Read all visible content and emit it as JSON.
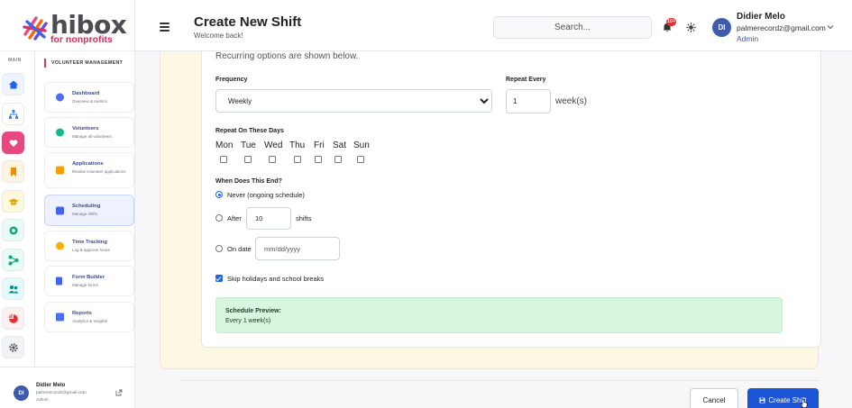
{
  "brand": {
    "name": "hibox",
    "tagline": "for nonprofits"
  },
  "header": {
    "title": "Create New Shift",
    "subtitle": "Welcome back!",
    "search_placeholder": "Search...",
    "notification_count": "10+",
    "user": {
      "initials": "DI",
      "name": "Didier Melo",
      "email": "palmerecordz@gmail.com",
      "role": "Admin"
    }
  },
  "rail": {
    "label": "MAIN",
    "items": [
      {
        "icon": "home-icon",
        "color": "#1c64f2",
        "bg": "#eef4ff"
      },
      {
        "icon": "org-chart-icon",
        "color": "#3b82f6",
        "bg": "#ffffff"
      },
      {
        "icon": "heart-hand-icon",
        "color": "#ffffff",
        "bg": "#e64980"
      },
      {
        "icon": "bookmark-icon",
        "color": "#f08c00",
        "bg": "#fff4e0"
      },
      {
        "icon": "graduation-cap-icon",
        "color": "#e0a800",
        "bg": "#fff8db"
      },
      {
        "icon": "circle-dot-icon",
        "color": "#0ca678",
        "bg": "#e6fcf5"
      },
      {
        "icon": "flow-icon",
        "color": "#0ca678",
        "bg": "#e6fcf5"
      },
      {
        "icon": "people-icon",
        "color": "#0c8599",
        "bg": "#e3fafc"
      },
      {
        "icon": "pie-chart-icon",
        "color": "#e03131",
        "bg": "#fff0f0"
      },
      {
        "icon": "gear-icon",
        "color": "#495057",
        "bg": "#f1f3f5"
      }
    ]
  },
  "menu": {
    "heading": "VOLUNTEER MANAGEMENT",
    "items": [
      {
        "title": "Dashboard",
        "subtitle": "Overview & metrics",
        "icon": "dashboard-icon",
        "color": "#4c6ef5"
      },
      {
        "title": "Volunteers",
        "subtitle": "Manage all volunteers",
        "icon": "volunteers-icon",
        "color": "#12b886"
      },
      {
        "title": "Applications",
        "subtitle": "Review volunteer applications",
        "icon": "applications-icon",
        "color": "#f59f00"
      },
      {
        "title": "Scheduling",
        "subtitle": "Manage shifts",
        "icon": "calendar-icon",
        "color": "#4263eb"
      },
      {
        "title": "Time Tracking",
        "subtitle": "Log & approve hours",
        "icon": "clock-icon",
        "color": "#fab005"
      },
      {
        "title": "Form Builder",
        "subtitle": "Manage forms",
        "icon": "form-icon",
        "color": "#4263eb"
      },
      {
        "title": "Reports",
        "subtitle": "Analytics & Insights",
        "icon": "reports-icon",
        "color": "#4c6ef5"
      }
    ]
  },
  "sidebar_user": {
    "initials": "DI",
    "name": "Didier Melo",
    "email": "palmerecordz@gmail.com",
    "role": "Admin"
  },
  "form": {
    "hint": "Recurring options are shown below.",
    "frequency_label": "Frequency",
    "frequency_value": "Weekly",
    "repeat_every_label": "Repeat Every",
    "repeat_every_value": "1",
    "repeat_unit": "week(s)",
    "days_label": "Repeat On These Days",
    "days": [
      "Mon",
      "Tue",
      "Wed",
      "Thu",
      "Fri",
      "Sat",
      "Sun"
    ],
    "end_label": "When Does This End?",
    "end_never": "Never (ongoing schedule)",
    "end_after": "After",
    "end_after_value": "10",
    "end_after_unit": "shifts",
    "end_on_date": "On date",
    "date_placeholder": "mm/dd/yyyy",
    "skip_label": "Skip holidays and school breaks",
    "preview_title": "Schedule Preview:",
    "preview_text": "Every 1 week(s)"
  },
  "actions": {
    "cancel": "Cancel",
    "create": "Create Shift"
  }
}
